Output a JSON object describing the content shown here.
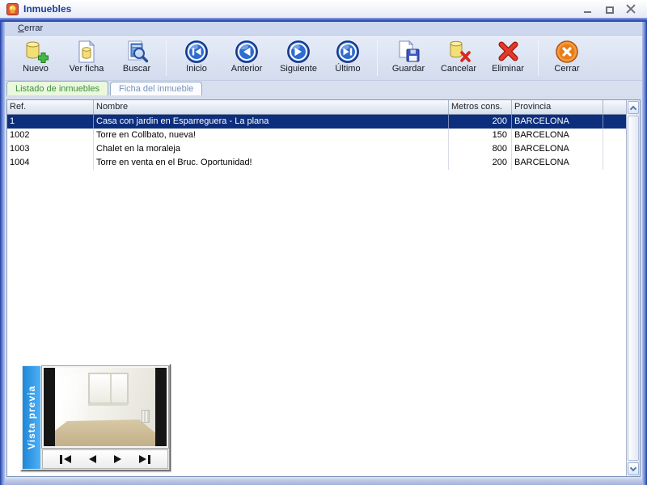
{
  "window": {
    "title": "Inmuebles"
  },
  "menu": {
    "close_item": {
      "label": "Cerrar",
      "accel": "C",
      "rest": "errar"
    }
  },
  "toolbar": {
    "buttons": [
      {
        "label": "Nuevo",
        "icon": "new-record-icon"
      },
      {
        "label": "Ver ficha",
        "icon": "view-record-icon"
      },
      {
        "label": "Buscar",
        "icon": "search-icon"
      },
      {
        "label": "Inicio",
        "icon": "first-record-icon"
      },
      {
        "label": "Anterior",
        "icon": "previous-record-icon"
      },
      {
        "label": "Siguiente",
        "icon": "next-record-icon"
      },
      {
        "label": "Último",
        "icon": "last-record-icon"
      },
      {
        "label": "Guardar",
        "icon": "save-icon"
      },
      {
        "label": "Cancelar",
        "icon": "cancel-icon"
      },
      {
        "label": "Eliminar",
        "icon": "delete-icon"
      },
      {
        "label": "Cerrar",
        "icon": "close-window-icon"
      }
    ]
  },
  "tabs": {
    "list": {
      "label": "Listado de inmuebles",
      "active": true
    },
    "detail": {
      "label": "Ficha del inmueble",
      "active": false
    }
  },
  "table": {
    "columns": [
      "Ref.",
      "Nombre",
      "Metros cons.",
      "Provincia"
    ],
    "selected_row_index": 0,
    "rows": [
      {
        "ref": "1",
        "nombre": "Casa con jardin en Esparreguera - La plana",
        "metros": "200",
        "provincia": "BARCELONA"
      },
      {
        "ref": "1002",
        "nombre": "Torre en Collbato, nueva!",
        "metros": "150",
        "provincia": "BARCELONA"
      },
      {
        "ref": "1003",
        "nombre": "Chalet en la moraleja",
        "metros": "800",
        "provincia": "BARCELONA"
      },
      {
        "ref": "1004",
        "nombre": "Torre en venta en el Bruc. Oportunidad!",
        "metros": "200",
        "provincia": "BARCELONA"
      }
    ]
  },
  "preview": {
    "title": "Vista previa",
    "nav": [
      "first",
      "previous",
      "next",
      "last"
    ]
  },
  "colors": {
    "selection_bg": "#0D2E7C",
    "active_tab_text": "#3F8F3F",
    "active_tab_bg": "#EAF8DD",
    "preview_strip_blue": "#2E9DF2",
    "toolbar_bg": "#D8DFEF",
    "title_text": "#1C3E96",
    "delete_red": "#D3281C",
    "close_orange": "#E87D18"
  }
}
